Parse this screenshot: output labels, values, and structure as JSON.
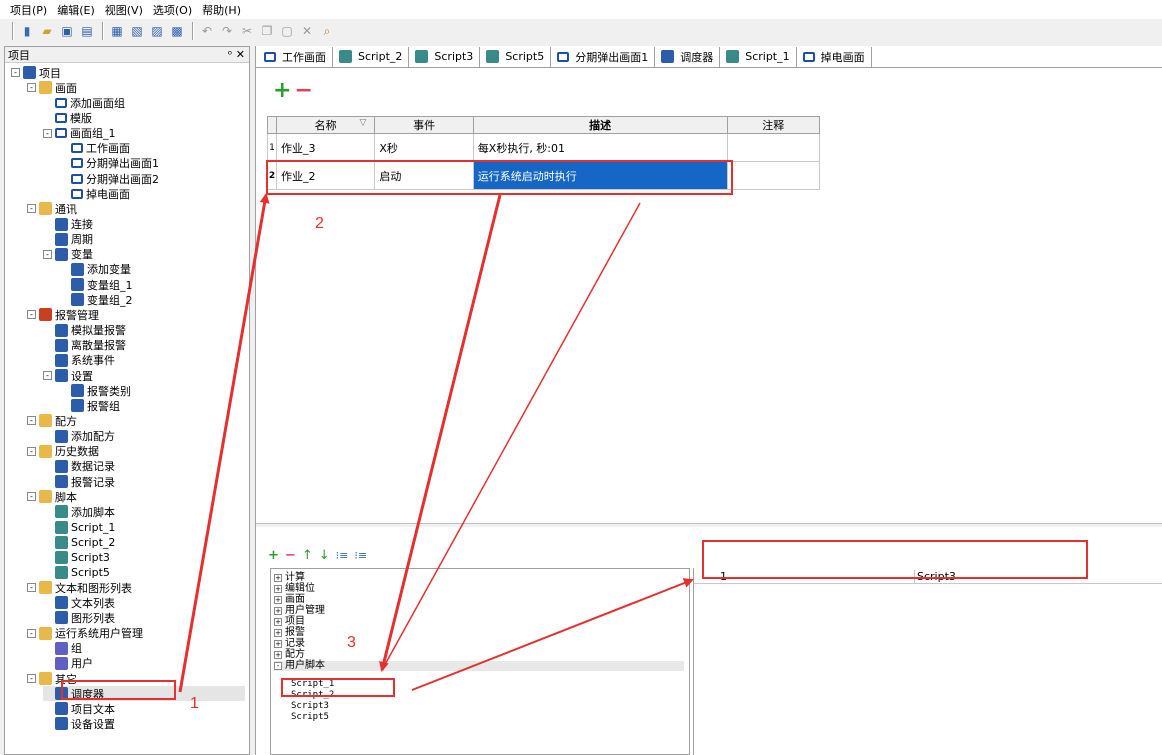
{
  "menu": [
    "项目(P)",
    "编辑(E)",
    "视图(V)",
    "选项(O)",
    "帮助(H)"
  ],
  "left_panel": {
    "title": "项目",
    "controls": "ᵒ ✕",
    "tree": [
      {
        "label": "项目",
        "depth": 0,
        "exp": "-",
        "icon": "building-icon"
      },
      {
        "label": "画面",
        "depth": 1,
        "exp": "-",
        "icon": "folder-icon"
      },
      {
        "label": "添加画面组",
        "depth": 2,
        "exp": "",
        "icon": "add-screen-group-icon"
      },
      {
        "label": "模版",
        "depth": 2,
        "exp": "",
        "icon": "template-icon"
      },
      {
        "label": "画面组_1",
        "depth": 2,
        "exp": "-",
        "icon": "screen-group-icon"
      },
      {
        "label": "工作画面",
        "depth": 3,
        "exp": "",
        "icon": "screen-icon"
      },
      {
        "label": "分期弹出画面1",
        "depth": 3,
        "exp": "",
        "icon": "screen-icon"
      },
      {
        "label": "分期弹出画面2",
        "depth": 3,
        "exp": "",
        "icon": "screen-icon"
      },
      {
        "label": "掉电画面",
        "depth": 3,
        "exp": "",
        "icon": "screen-icon"
      },
      {
        "label": "通讯",
        "depth": 1,
        "exp": "-",
        "icon": "comm-icon"
      },
      {
        "label": "连接",
        "depth": 2,
        "exp": "",
        "icon": "connection-icon"
      },
      {
        "label": "周期",
        "depth": 2,
        "exp": "",
        "icon": "cycle-icon"
      },
      {
        "label": "变量",
        "depth": 2,
        "exp": "-",
        "icon": "variable-icon"
      },
      {
        "label": "添加变量",
        "depth": 3,
        "exp": "",
        "icon": "add-variable-icon"
      },
      {
        "label": "变量组_1",
        "depth": 3,
        "exp": "",
        "icon": "variable-group-icon"
      },
      {
        "label": "变量组_2",
        "depth": 3,
        "exp": "",
        "icon": "variable-group-icon"
      },
      {
        "label": "报警管理",
        "depth": 1,
        "exp": "-",
        "icon": "alarm-icon"
      },
      {
        "label": "模拟量报警",
        "depth": 2,
        "exp": "",
        "icon": "analog-alarm-icon"
      },
      {
        "label": "离散量报警",
        "depth": 2,
        "exp": "",
        "icon": "discrete-alarm-icon"
      },
      {
        "label": "系统事件",
        "depth": 2,
        "exp": "",
        "icon": "system-event-icon"
      },
      {
        "label": "设置",
        "depth": 2,
        "exp": "-",
        "icon": "settings-icon"
      },
      {
        "label": "报警类别",
        "depth": 3,
        "exp": "",
        "icon": "alarm-class-icon"
      },
      {
        "label": "报警组",
        "depth": 3,
        "exp": "",
        "icon": "alarm-group-icon"
      },
      {
        "label": "配方",
        "depth": 1,
        "exp": "-",
        "icon": "recipe-icon"
      },
      {
        "label": "添加配方",
        "depth": 2,
        "exp": "",
        "icon": "add-recipe-icon"
      },
      {
        "label": "历史数据",
        "depth": 1,
        "exp": "-",
        "icon": "history-icon"
      },
      {
        "label": "数据记录",
        "depth": 2,
        "exp": "",
        "icon": "data-log-icon"
      },
      {
        "label": "报警记录",
        "depth": 2,
        "exp": "",
        "icon": "alarm-log-icon"
      },
      {
        "label": "脚本",
        "depth": 1,
        "exp": "-",
        "icon": "script-folder-icon"
      },
      {
        "label": "添加脚本",
        "depth": 2,
        "exp": "",
        "icon": "add-script-icon"
      },
      {
        "label": "Script_1",
        "depth": 2,
        "exp": "",
        "icon": "script-icon"
      },
      {
        "label": "Script_2",
        "depth": 2,
        "exp": "",
        "icon": "script-icon"
      },
      {
        "label": "Script3",
        "depth": 2,
        "exp": "",
        "icon": "script-icon"
      },
      {
        "label": "Script5",
        "depth": 2,
        "exp": "",
        "icon": "script-icon"
      },
      {
        "label": "文本和图形列表",
        "depth": 1,
        "exp": "-",
        "icon": "list-folder-icon"
      },
      {
        "label": "文本列表",
        "depth": 2,
        "exp": "",
        "icon": "text-list-icon"
      },
      {
        "label": "图形列表",
        "depth": 2,
        "exp": "",
        "icon": "graphic-list-icon"
      },
      {
        "label": "运行系统用户管理",
        "depth": 1,
        "exp": "-",
        "icon": "user-admin-icon"
      },
      {
        "label": "组",
        "depth": 2,
        "exp": "",
        "icon": "group-icon"
      },
      {
        "label": "用户",
        "depth": 2,
        "exp": "",
        "icon": "user-icon"
      },
      {
        "label": "其它",
        "depth": 1,
        "exp": "-",
        "icon": "other-folder-icon"
      },
      {
        "label": "调度器",
        "depth": 2,
        "exp": "",
        "icon": "scheduler-icon",
        "selected": true
      },
      {
        "label": "项目文本",
        "depth": 2,
        "exp": "",
        "icon": "project-text-icon"
      },
      {
        "label": "设备设置",
        "depth": 2,
        "exp": "",
        "icon": "device-settings-icon"
      }
    ]
  },
  "tabs": [
    "工作画面",
    "Script_2",
    "Script3",
    "Script5",
    "分期弹出画面1",
    "调度器",
    "Script_1",
    "掉电画面"
  ],
  "grid": {
    "headers": [
      "名称",
      "事件",
      "描述",
      "注释"
    ],
    "sort_glyph": "▽",
    "rows": [
      {
        "num": "1",
        "name": "作业_3",
        "event": "X秒",
        "desc": "每X秒执行, 秒:01",
        "note": ""
      },
      {
        "num": "2",
        "name": "作业_2",
        "event": "启动",
        "desc": "运行系统启动时执行",
        "note": ""
      }
    ]
  },
  "lower_toolbar": [
    "+",
    "−",
    "↑",
    "↓",
    "⁝≡",
    "⁝≡"
  ],
  "lower_tree": {
    "categories": [
      "计算",
      "编辑位",
      "画面",
      "用户管理",
      "项目",
      "报警",
      "记录",
      "配方",
      "用户脚本"
    ],
    "user_scripts": [
      "Script_1",
      "Script_2",
      "Script3",
      "Script5"
    ]
  },
  "lower_right": {
    "index": "1",
    "script": "Script3"
  },
  "annotations": {
    "labels": [
      "1",
      "2",
      "3"
    ],
    "color": "#e53030"
  }
}
